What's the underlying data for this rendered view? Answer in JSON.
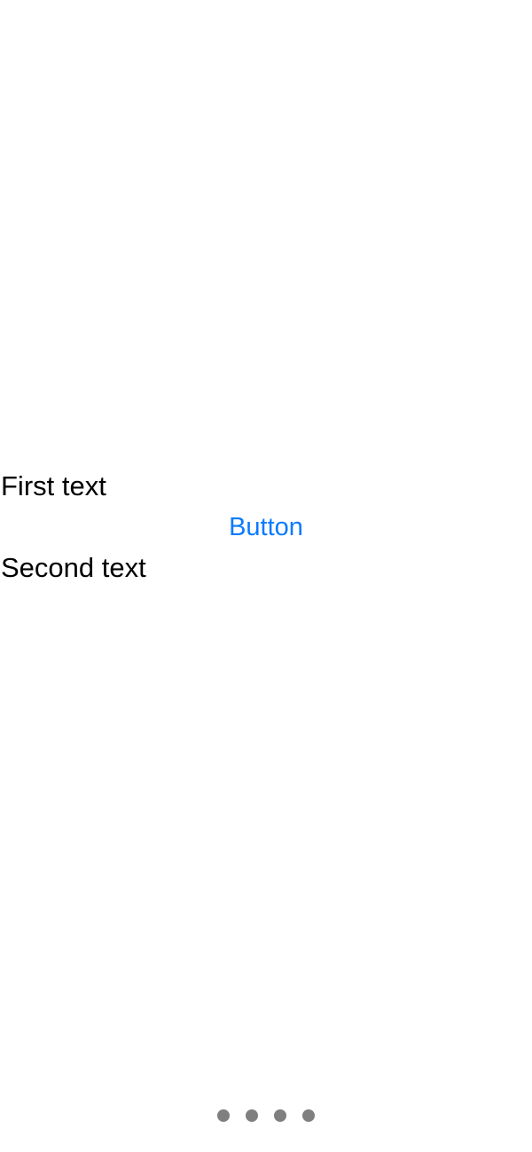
{
  "main": {
    "first_text": "First text",
    "button_label": "Button",
    "second_text": "Second text"
  },
  "page_control": {
    "page_count": 4,
    "dot_color": "#7f7f7f"
  },
  "colors": {
    "accent": "#0a7aff",
    "text": "#000000",
    "background": "#ffffff"
  }
}
